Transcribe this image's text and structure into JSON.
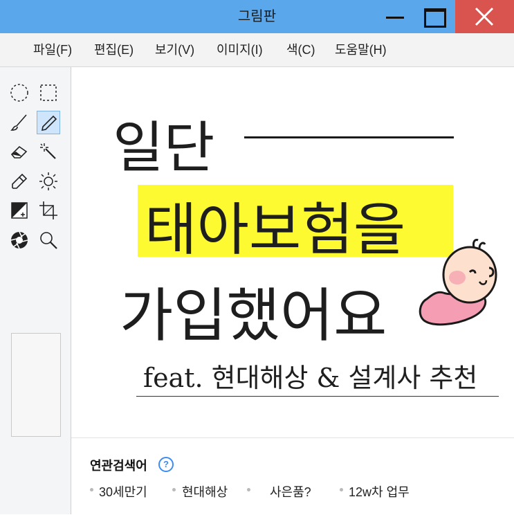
{
  "window": {
    "title": "그림판"
  },
  "menu": {
    "items": [
      "파일(F)",
      "편집(E)",
      "보기(V)",
      "이미지(I)",
      "색(C)",
      "도움말(H)"
    ]
  },
  "tools": [
    {
      "name": "ellipse-select-icon"
    },
    {
      "name": "rect-select-icon"
    },
    {
      "name": "brush-icon"
    },
    {
      "name": "pencil-icon",
      "active": true
    },
    {
      "name": "eraser-icon"
    },
    {
      "name": "magic-wand-icon"
    },
    {
      "name": "eyedropper-icon"
    },
    {
      "name": "brightness-icon"
    },
    {
      "name": "contrast-icon"
    },
    {
      "name": "crop-icon"
    },
    {
      "name": "aperture-icon"
    },
    {
      "name": "zoom-icon"
    }
  ],
  "canvas": {
    "line1": "일단",
    "line2": "태아보험을",
    "line3": "가입했어요",
    "subtitle": "feat. 현대해상 & 설계사 추천",
    "highlight_color": "#fdfa32"
  },
  "related": {
    "title": "연관검색어",
    "help": "?",
    "tags": [
      "30세만기",
      "현대해상",
      "사은품?",
      "12w차 업무"
    ]
  },
  "colors": {
    "titlebar": "#5aa7ec",
    "close": "#d9534f",
    "accent": "#3d8cf0"
  }
}
